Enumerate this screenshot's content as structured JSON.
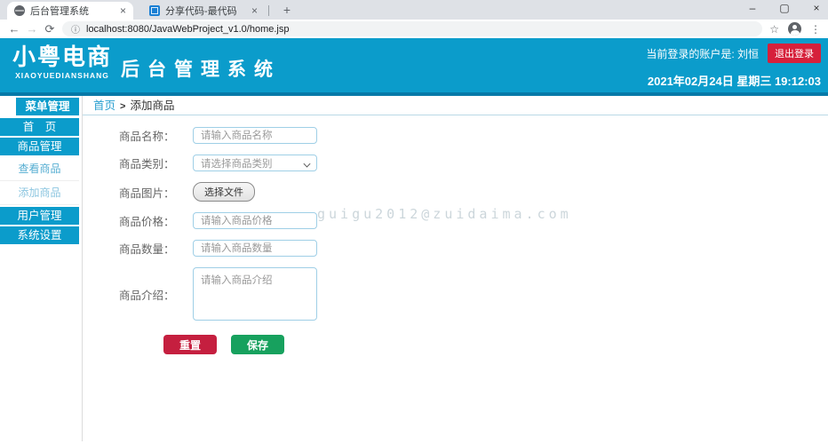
{
  "browser": {
    "tabs": [
      {
        "title": "后台管理系统",
        "icon": "globe-favicon",
        "close": "×"
      },
      {
        "title": "分享代码-最代码",
        "icon": "zuidaima-favicon",
        "close": "×"
      }
    ],
    "newtab": "+",
    "url": "localhost:8080/JavaWebProject_v1.0/home.jsp",
    "window_controls": {
      "minimize": "–",
      "maximize": "▢",
      "close": "×"
    },
    "nav": {
      "back": "←",
      "forward": "→",
      "reload": "⟳",
      "info": "ⓘ",
      "star": "☆",
      "menu": "⋮"
    }
  },
  "header": {
    "logo_main": "小粤电商",
    "logo_sub": "XIAOYUEDIANSHANG",
    "title": "后台管理系统",
    "account_label": "当前登录的账户是: 刘恒",
    "logout_label": "退出登录",
    "datetime": "2021年02月24日 星期三 19:12:03"
  },
  "sidebar": {
    "header": "菜单管理",
    "items": [
      {
        "label": "首　页"
      },
      {
        "label": "商品管理"
      },
      {
        "label": "查看商品"
      },
      {
        "label": "添加商品"
      },
      {
        "label": "用户管理"
      },
      {
        "label": "系统设置"
      }
    ]
  },
  "breadcrumb": {
    "home": "首页",
    "separator": ">",
    "current": "添加商品"
  },
  "form": {
    "fields": [
      {
        "label": "商品名称：",
        "placeholder": "请输入商品名称"
      },
      {
        "label": "商品类别：",
        "placeholder": "请选择商品类别"
      },
      {
        "label": "商品图片：",
        "button_label": "选择文件"
      },
      {
        "label": "商品价格：",
        "placeholder": "请输入商品价格"
      },
      {
        "label": "商品数量：",
        "placeholder": "请输入商品数量"
      },
      {
        "label": "商品介绍：",
        "placeholder": "请输入商品介绍"
      }
    ],
    "reset_label": "重置",
    "save_label": "保存"
  },
  "watermark": "guigu2012@zuidaima.com",
  "colors": {
    "header_teal": "#0b9ccb",
    "header_border": "#0779a8",
    "logout_red": "#d6203b",
    "reset_red": "#c51f3f",
    "save_green": "#17a15e",
    "link_blue": "#2a9fd0",
    "input_border": "#9fcfe6"
  }
}
